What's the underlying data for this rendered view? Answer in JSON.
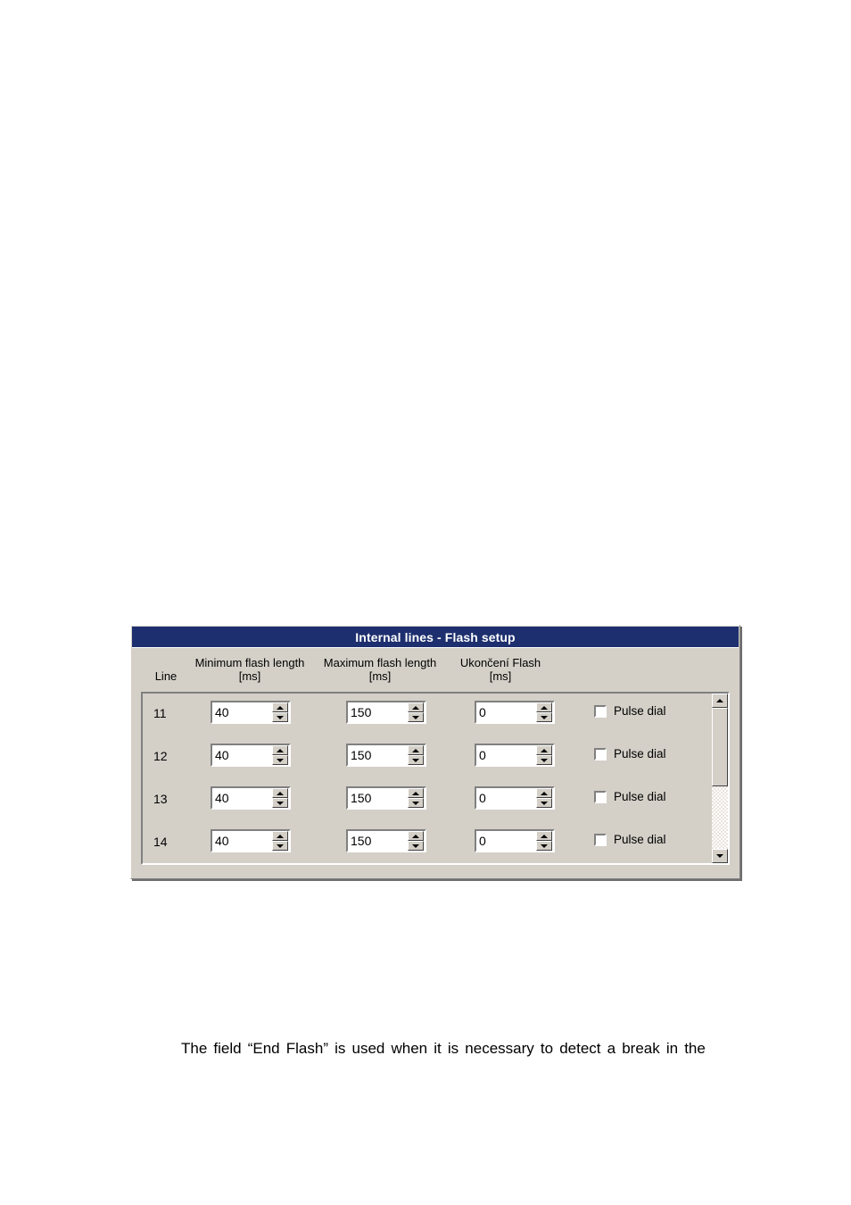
{
  "document": {
    "caption": "The field “End Flash” is used when it is necessary to detect a break in the"
  },
  "dialog": {
    "title": "Internal lines - Flash setup",
    "headers": {
      "line": "Line",
      "min_flash_l1": "Minimum flash length",
      "min_flash_l2": "[ms]",
      "max_flash_l1": "Maximum flash length",
      "max_flash_l2": "[ms]",
      "end_flash_l1": "Ukončení Flash",
      "end_flash_l2": "[ms]"
    },
    "colors": {
      "titlebar": "#1d2f6e",
      "titlebar_text": "#ffffff",
      "panel": "#d4d0c8",
      "field": "#ffffff",
      "shadow": "#808080"
    },
    "rows": [
      {
        "line": "11",
        "min_flash": "40",
        "max_flash": "150",
        "end_flash": "0",
        "pulse_dial_label": "Pulse dial",
        "pulse_dial_checked": false
      },
      {
        "line": "12",
        "min_flash": "40",
        "max_flash": "150",
        "end_flash": "0",
        "pulse_dial_label": "Pulse dial",
        "pulse_dial_checked": false
      },
      {
        "line": "13",
        "min_flash": "40",
        "max_flash": "150",
        "end_flash": "0",
        "pulse_dial_label": "Pulse dial",
        "pulse_dial_checked": false
      },
      {
        "line": "14",
        "min_flash": "40",
        "max_flash": "150",
        "end_flash": "0",
        "pulse_dial_label": "Pulse dial",
        "pulse_dial_checked": false
      }
    ],
    "scrollbar": {
      "up_icon": "triangle-up-icon",
      "down_icon": "triangle-down-icon",
      "thumb_position": "top"
    },
    "spinner_icons": {
      "up": "triangle-up-icon",
      "down": "triangle-down-icon"
    }
  }
}
